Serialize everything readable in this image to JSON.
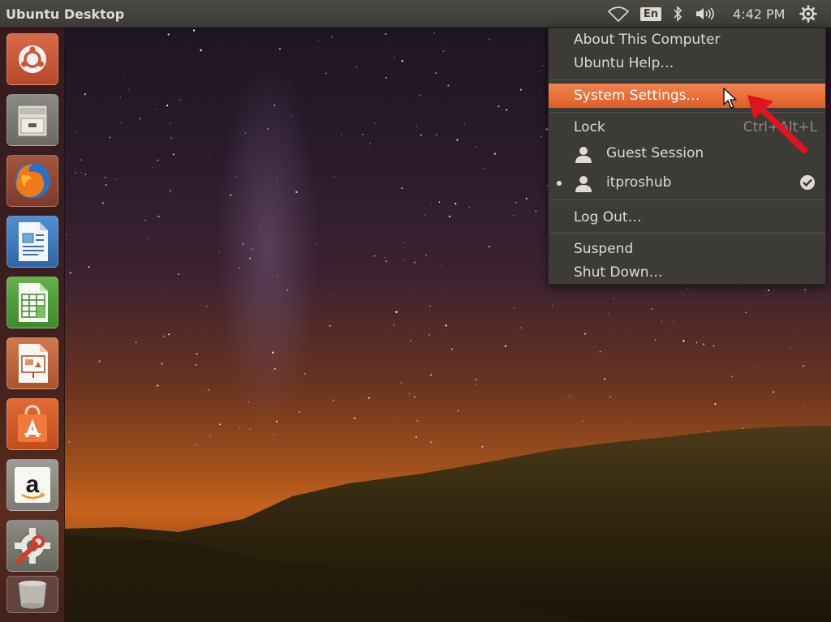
{
  "panel": {
    "title": "Ubuntu Desktop",
    "language": "En",
    "clock": "4:42 PM",
    "indicators": [
      "wifi-icon",
      "bluetooth-icon",
      "volume-icon",
      "gear-icon"
    ]
  },
  "launcher": {
    "items": [
      {
        "name": "dash-home",
        "icon": "ubuntu-logo-icon"
      },
      {
        "name": "files",
        "icon": "file-cabinet-icon"
      },
      {
        "name": "firefox",
        "icon": "firefox-icon"
      },
      {
        "name": "libreoffice-writer",
        "icon": "writer-document-icon"
      },
      {
        "name": "libreoffice-calc",
        "icon": "calc-spreadsheet-icon"
      },
      {
        "name": "libreoffice-impress",
        "icon": "impress-presentation-icon"
      },
      {
        "name": "ubuntu-software",
        "icon": "shopping-bag-icon"
      },
      {
        "name": "amazon",
        "icon": "amazon-icon"
      },
      {
        "name": "system-settings",
        "icon": "settings-wrench-gear-icon"
      },
      {
        "name": "trash",
        "icon": "trash-icon"
      }
    ]
  },
  "session_menu": {
    "about": "About This Computer",
    "help": "Ubuntu Help…",
    "system_settings": "System Settings…",
    "lock": "Lock",
    "lock_shortcut": "Ctrl+Alt+L",
    "guest": "Guest Session",
    "user": "itproshub",
    "logout": "Log Out…",
    "suspend": "Suspend",
    "shutdown": "Shut Down…"
  },
  "colors": {
    "panel_bg": "#3c3b37",
    "menu_highlight": "#e8703a",
    "annotation_arrow": "#e0141c",
    "launcher_bg": "#3c1e1e"
  }
}
